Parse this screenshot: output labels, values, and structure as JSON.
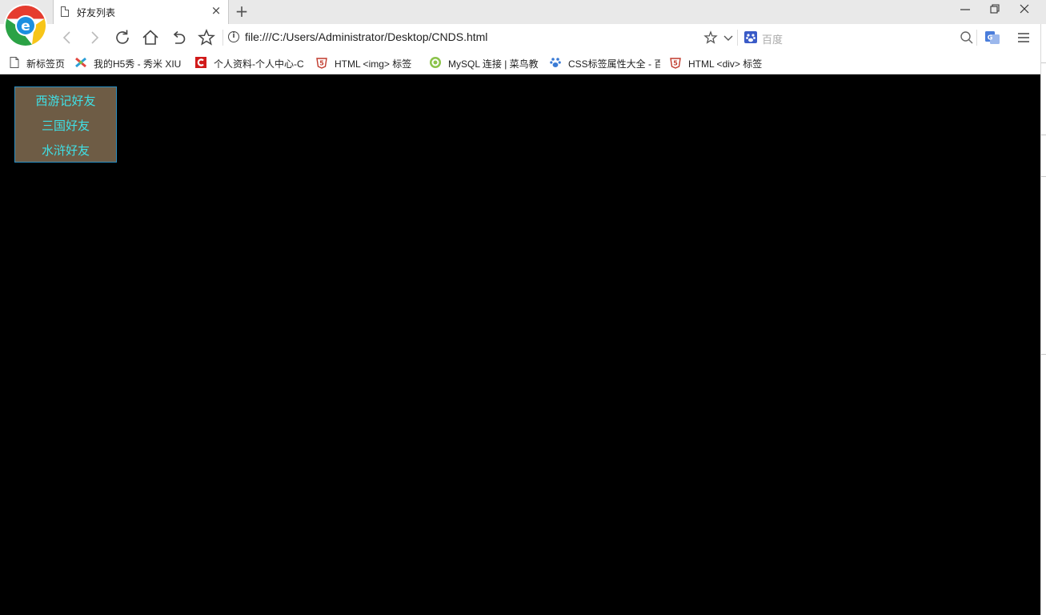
{
  "tab": {
    "title": "好友列表",
    "close_glyph": "×"
  },
  "newtab_glyph": "+",
  "window": {
    "minimize_glyph": "—",
    "restore_glyph": "❐",
    "close_glyph": "✕"
  },
  "address": {
    "url": "file:///C:/Users/Administrator/Desktop/CNDS.html",
    "info_glyph": "i"
  },
  "search": {
    "placeholder": "百度"
  },
  "bookmarks": [
    {
      "label": "新标签页",
      "icon": "page-icon"
    },
    {
      "label": "我的H5秀 - 秀米 XIU",
      "icon": "xiumi-icon"
    },
    {
      "label": "个人资料-个人中心-C",
      "icon": "csdn-icon"
    },
    {
      "label": "HTML <img> 标签",
      "icon": "w3school-icon"
    },
    {
      "label": "MySQL 连接 | 菜鸟教",
      "icon": "runoob-icon"
    },
    {
      "label": "CSS标签属性大全 - 百",
      "icon": "baidu-paw-icon"
    },
    {
      "label": "HTML <div> 标签",
      "icon": "w3school-icon"
    }
  ],
  "friend_menu": {
    "items": [
      "西游记好友",
      "三国好友",
      "水浒好友"
    ],
    "background": "#6e5c45",
    "text_color": "#3fe0e6",
    "border_color": "#2a8fc4"
  },
  "page_background": "#000000"
}
